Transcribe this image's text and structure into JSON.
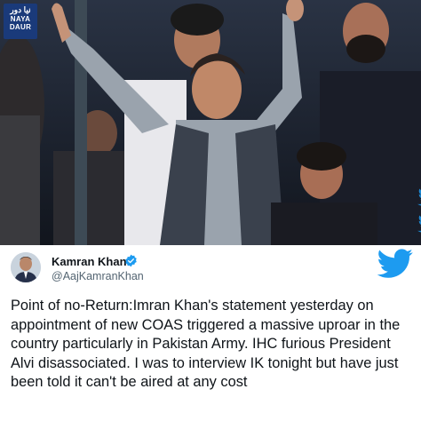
{
  "logo": {
    "urdu": "نیا دور",
    "line1": "NAYA",
    "line2": "DAUR"
  },
  "tweet": {
    "author_name": "Kamran Khan",
    "handle": "@AajKamranKhan",
    "text": "Point of no-Return:Imran Khan's statement yesterday on appointment of new COAS triggered a massive uproar in the country particularly in Pakistan Army. IHC furious President Alvi disassociated. I was to interview IK tonight but have just been told it can't be aired at any cost"
  },
  "colors": {
    "twitter_blue": "#1d9bf0",
    "logo_bg": "#1a3a7a"
  },
  "icons": [
    "twitter-bird-icon",
    "verified-badge-icon"
  ]
}
